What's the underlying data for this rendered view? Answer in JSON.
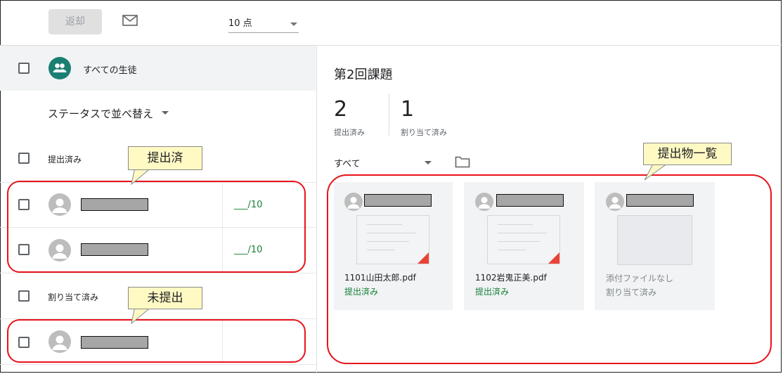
{
  "toolbar": {
    "return_label": "返却",
    "points_value": "10 点"
  },
  "left": {
    "all_students": "すべての生徒",
    "sort_label": "ステータスで並べ替え",
    "submitted_header": "提出済み",
    "assigned_header": "割り当て済み",
    "grade_placeholder": "___/10"
  },
  "callouts": {
    "submitted": "提出済",
    "not_submitted": "未提出",
    "submissions_list": "提出物一覧"
  },
  "right": {
    "title": "第2回課題",
    "stats": [
      {
        "value": "2",
        "label": "提出済み"
      },
      {
        "value": "1",
        "label": "割り当て済み"
      }
    ],
    "filter_label": "すべて",
    "cards": [
      {
        "filename": "1101山田太郎.pdf",
        "status": "提出済み"
      },
      {
        "filename": "1102岩鬼正美.pdf",
        "status": "提出済み"
      },
      {
        "filename": "添付ファイルなし",
        "status": "割り当て済み"
      }
    ]
  },
  "colors": {
    "accent_green": "#188038",
    "highlight_red": "#e8131b",
    "callout_yellow": "#fff9c4",
    "group_teal": "#1a7f72"
  }
}
